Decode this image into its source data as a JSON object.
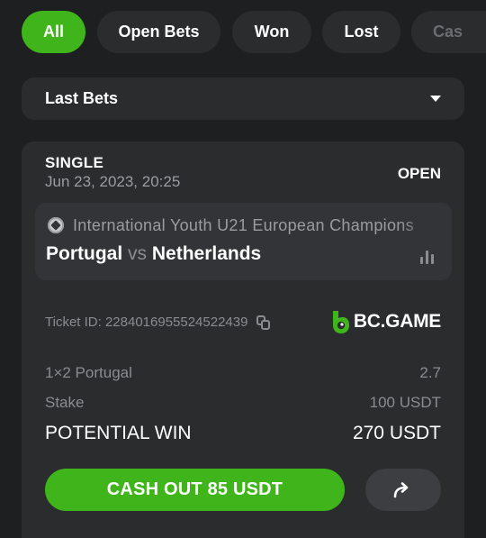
{
  "tabs": [
    {
      "label": "All",
      "active": true
    },
    {
      "label": "Open Bets",
      "active": false
    },
    {
      "label": "Won",
      "active": false
    },
    {
      "label": "Lost",
      "active": false
    },
    {
      "label": "Cas",
      "active": false
    }
  ],
  "filter": {
    "selected": "Last Bets"
  },
  "bet": {
    "type": "SINGLE",
    "date": "Jun 23, 2023, 20:25",
    "status": "OPEN",
    "league": "International Youth U21 European Champions",
    "home_team": "Portugal",
    "vs": "vs",
    "away_team": "Netherlands",
    "ticket_label": "Ticket ID: 2284016955524522439",
    "brand": "BC.GAME",
    "selection_label": "1×2 Portugal",
    "odds": "2.7",
    "stake_label": "Stake",
    "stake_value": "100 USDT",
    "potential_win_label": "POTENTIAL WIN",
    "potential_win_value": "270 USDT",
    "cashout_label": "CASH OUT 85 USDT"
  },
  "colors": {
    "accent": "#3fb51b",
    "background": "#1e1f21",
    "card": "#2a2c2e"
  },
  "icons": [
    "chevron-down-icon",
    "soccer-ball-icon",
    "stats-icon",
    "copy-icon",
    "bc-game-logo-icon",
    "share-arrow-icon"
  ]
}
